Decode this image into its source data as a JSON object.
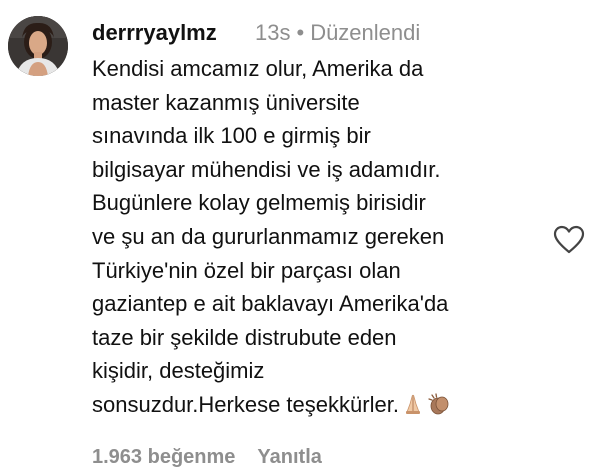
{
  "comment": {
    "username": "derrryaylmz",
    "time": "13s",
    "separator": "•",
    "edited_label": "Düzenlendi",
    "text_lines": [
      "Kendisi amcamız olur, Amerika da",
      "master kazanmış üniversite",
      "sınavında ilk 100 e girmiş bir",
      "bilgisayar mühendisi ve iş adamıdır.",
      "Bugünlere kolay gelmemiş birisidir",
      "ve şu an da gururlanmamız gereken",
      "Türkiye'nin özel bir parçası olan",
      "gaziantep e ait baklavayı Amerika'da",
      "taze bir şekilde distrubute eden",
      "kişidir, desteğimiz",
      "sonsuzdur.Herkese teşekkürler."
    ],
    "end_emojis": [
      "folded-hands-icon",
      "clapping-hands-icon"
    ],
    "likes_text": "1.963 beğenme",
    "reply_label": "Yanıtla"
  },
  "icons": {
    "like": "heart-outline-icon",
    "avatar": "avatar"
  },
  "colors": {
    "text": "#111111",
    "muted": "#8e8e8e",
    "background": "#ffffff"
  }
}
